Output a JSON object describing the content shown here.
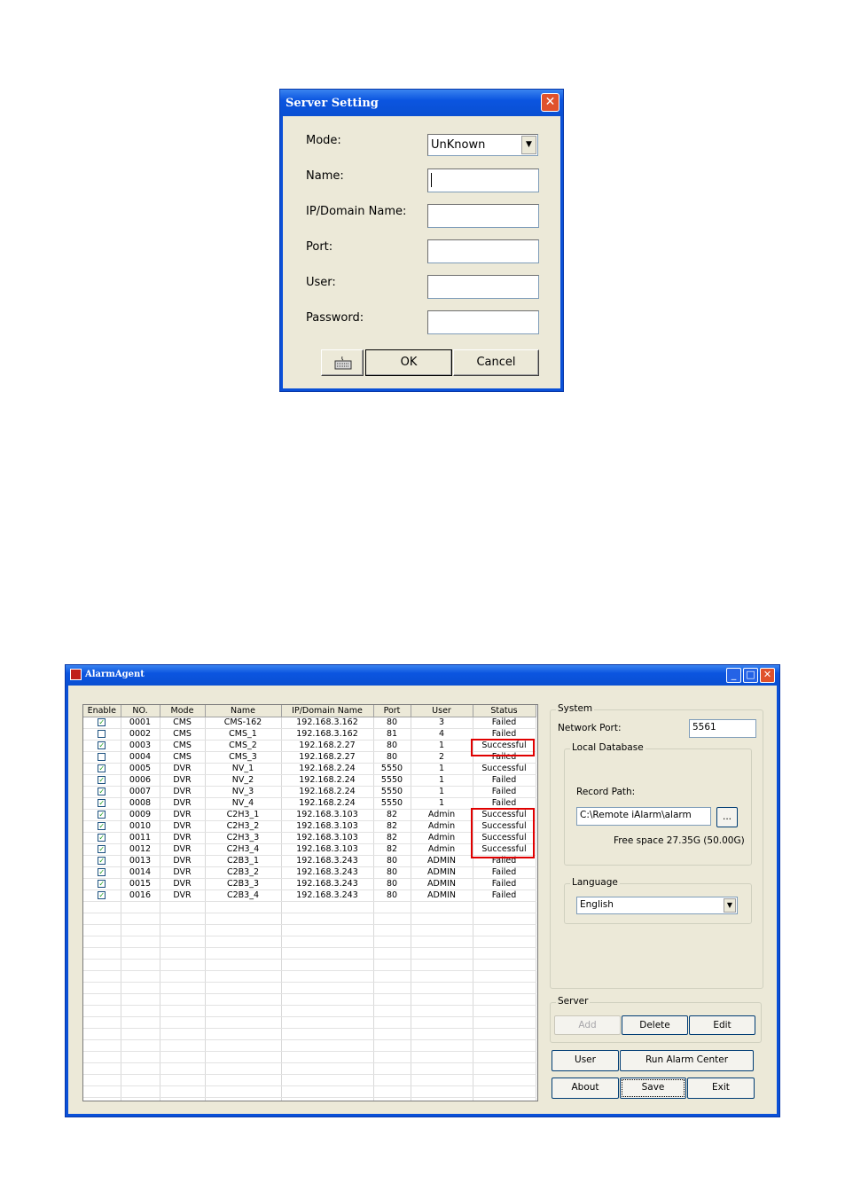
{
  "server_dialog": {
    "title": "Server Setting",
    "close_label": "✕",
    "mode_label": "Mode:",
    "mode_value": "UnKnown",
    "name_label": "Name:",
    "ip_label": "IP/Domain Name:",
    "port_label": "Port:",
    "user_label": "User:",
    "password_label": "Password:",
    "keyboard_icon": "keyboard-icon",
    "ok_label": "OK",
    "cancel_label": "Cancel"
  },
  "alarm_agent": {
    "title": "AlarmAgent",
    "columns": [
      "Enable",
      "NO.",
      "Mode",
      "Name",
      "IP/Domain Name",
      "Port",
      "User",
      "Status"
    ],
    "rows": [
      {
        "enabled": true,
        "no": "0001",
        "mode": "CMS",
        "name": "CMS-162",
        "ip": "192.168.3.162",
        "port": "80",
        "user": "3",
        "status": "Failed"
      },
      {
        "enabled": false,
        "no": "0002",
        "mode": "CMS",
        "name": "CMS_1",
        "ip": "192.168.3.162",
        "port": "81",
        "user": "4",
        "status": "Failed"
      },
      {
        "enabled": true,
        "no": "0003",
        "mode": "CMS",
        "name": "CMS_2",
        "ip": "192.168.2.27",
        "port": "80",
        "user": "1",
        "status": "Successful"
      },
      {
        "enabled": false,
        "no": "0004",
        "mode": "CMS",
        "name": "CMS_3",
        "ip": "192.168.2.27",
        "port": "80",
        "user": "2",
        "status": "Failed"
      },
      {
        "enabled": true,
        "no": "0005",
        "mode": "DVR",
        "name": "NV_1",
        "ip": "192.168.2.24",
        "port": "5550",
        "user": "1",
        "status": "Successful"
      },
      {
        "enabled": true,
        "no": "0006",
        "mode": "DVR",
        "name": "NV_2",
        "ip": "192.168.2.24",
        "port": "5550",
        "user": "1",
        "status": "Failed"
      },
      {
        "enabled": true,
        "no": "0007",
        "mode": "DVR",
        "name": "NV_3",
        "ip": "192.168.2.24",
        "port": "5550",
        "user": "1",
        "status": "Failed"
      },
      {
        "enabled": true,
        "no": "0008",
        "mode": "DVR",
        "name": "NV_4",
        "ip": "192.168.2.24",
        "port": "5550",
        "user": "1",
        "status": "Failed"
      },
      {
        "enabled": true,
        "no": "0009",
        "mode": "DVR",
        "name": "C2H3_1",
        "ip": "192.168.3.103",
        "port": "82",
        "user": "Admin",
        "status": "Successful"
      },
      {
        "enabled": true,
        "no": "0010",
        "mode": "DVR",
        "name": "C2H3_2",
        "ip": "192.168.3.103",
        "port": "82",
        "user": "Admin",
        "status": "Successful"
      },
      {
        "enabled": true,
        "no": "0011",
        "mode": "DVR",
        "name": "C2H3_3",
        "ip": "192.168.3.103",
        "port": "82",
        "user": "Admin",
        "status": "Successful"
      },
      {
        "enabled": true,
        "no": "0012",
        "mode": "DVR",
        "name": "C2H3_4",
        "ip": "192.168.3.103",
        "port": "82",
        "user": "Admin",
        "status": "Successful"
      },
      {
        "enabled": true,
        "no": "0013",
        "mode": "DVR",
        "name": "C2B3_1",
        "ip": "192.168.3.243",
        "port": "80",
        "user": "ADMIN",
        "status": "Failed"
      },
      {
        "enabled": true,
        "no": "0014",
        "mode": "DVR",
        "name": "C2B3_2",
        "ip": "192.168.3.243",
        "port": "80",
        "user": "ADMIN",
        "status": "Failed"
      },
      {
        "enabled": true,
        "no": "0015",
        "mode": "DVR",
        "name": "C2B3_3",
        "ip": "192.168.3.243",
        "port": "80",
        "user": "ADMIN",
        "status": "Failed"
      },
      {
        "enabled": true,
        "no": "0016",
        "mode": "DVR",
        "name": "C2B3_4",
        "ip": "192.168.3.243",
        "port": "80",
        "user": "ADMIN",
        "status": "Failed"
      }
    ],
    "highlight_color": "#e00000",
    "system": {
      "group_label": "System",
      "network_port_label": "Network Port:",
      "network_port_value": "5561",
      "local_db_label": "Local Database",
      "record_path_label": "Record Path:",
      "record_path_value": "C:\\Remote iAlarm\\alarm",
      "browse_label": "...",
      "free_space": "Free space 27.35G (50.00G)",
      "language_label": "Language",
      "language_value": "English"
    },
    "server": {
      "group_label": "Server",
      "add_label": "Add",
      "delete_label": "Delete",
      "edit_label": "Edit"
    },
    "buttons": {
      "user": "User",
      "run_alarm_center": "Run Alarm Center",
      "about": "About",
      "save": "Save",
      "exit": "Exit"
    }
  }
}
